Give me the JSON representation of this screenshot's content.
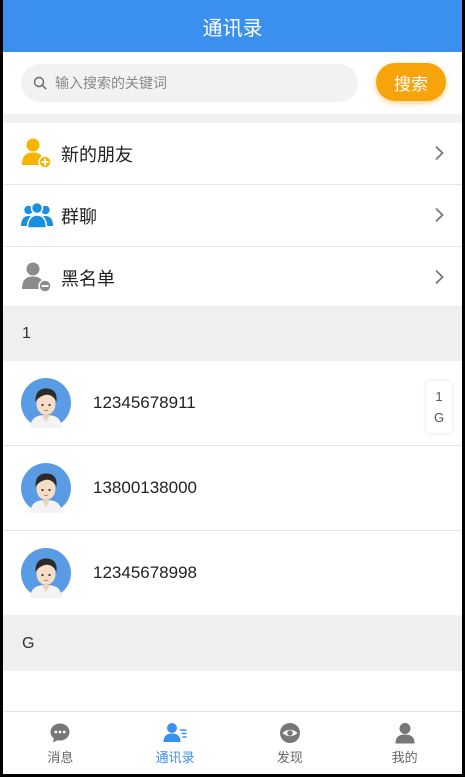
{
  "header": {
    "title": "通讯录"
  },
  "search": {
    "placeholder": "输入搜索的关键词",
    "button_label": "搜索"
  },
  "menu": [
    {
      "label": "新的朋友",
      "icon": "add-user-icon",
      "color": "#f7b500"
    },
    {
      "label": "群聊",
      "icon": "group-icon",
      "color": "#1a8fe0"
    },
    {
      "label": "黑名单",
      "icon": "blocked-user-icon",
      "color": "#8c8c8c"
    }
  ],
  "sections": [
    {
      "letter": "1",
      "contacts": [
        "12345678911",
        "13800138000",
        "12345678998"
      ]
    },
    {
      "letter": "G",
      "contacts": []
    }
  ],
  "index_bar": [
    "1",
    "G"
  ],
  "tabbar": [
    {
      "label": "消息",
      "icon": "chat-icon",
      "active": false
    },
    {
      "label": "通讯录",
      "icon": "contacts-icon",
      "active": true
    },
    {
      "label": "发现",
      "icon": "eye-icon",
      "active": false
    },
    {
      "label": "我的",
      "icon": "person-icon",
      "active": false
    }
  ],
  "colors": {
    "primary": "#3b8fef",
    "accent": "#f7a40b"
  }
}
